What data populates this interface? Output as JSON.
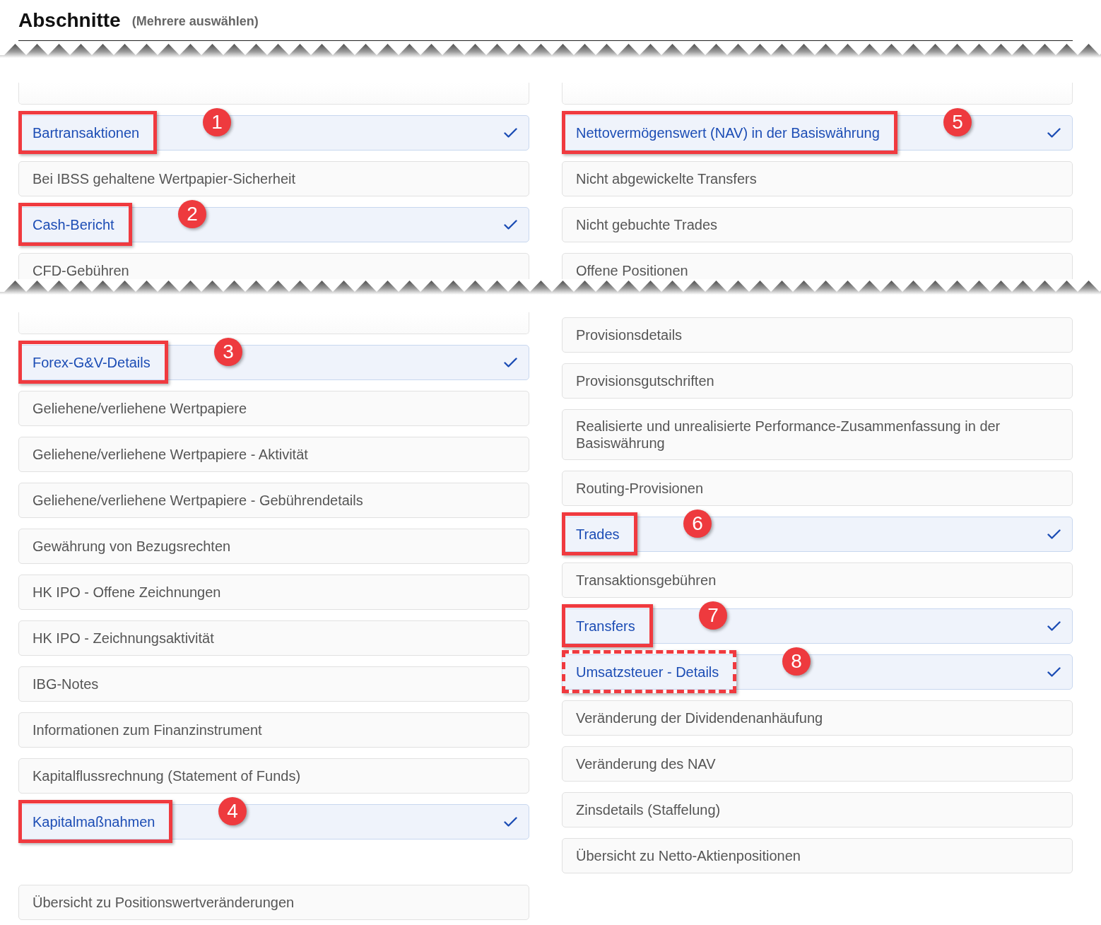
{
  "header": {
    "title": "Abschnitte",
    "hint": "(Mehrere auswählen)"
  },
  "segments": [
    {
      "columns": [
        {
          "items": [
            {
              "kind": "cut"
            },
            {
              "kind": "option",
              "label": "Bartransaktionen",
              "selected": true,
              "annotation": {
                "kind": "box",
                "number": "1"
              }
            },
            {
              "kind": "option",
              "label": "Bei IBSS gehaltene Wertpapier-Sicherheit",
              "selected": false
            },
            {
              "kind": "option",
              "label": "Cash-Bericht",
              "selected": true,
              "annotation": {
                "kind": "box",
                "number": "2"
              }
            },
            {
              "kind": "option",
              "label": "CFD-Gebühren",
              "selected": false
            }
          ]
        },
        {
          "items": [
            {
              "kind": "cut"
            },
            {
              "kind": "option",
              "label": "Nettovermögenswert (NAV) in der Basiswährung",
              "selected": true,
              "annotation": {
                "kind": "box",
                "number": "5"
              }
            },
            {
              "kind": "option",
              "label": "Nicht abgewickelte Transfers",
              "selected": false
            },
            {
              "kind": "option",
              "label": "Nicht gebuchte Trades",
              "selected": false
            },
            {
              "kind": "option",
              "label": "Offene Positionen",
              "selected": false
            }
          ]
        }
      ]
    },
    {
      "columns": [
        {
          "items": [
            {
              "kind": "cut"
            },
            {
              "kind": "option",
              "label": "Forex-G&V-Details",
              "selected": true,
              "annotation": {
                "kind": "box",
                "number": "3"
              }
            },
            {
              "kind": "option",
              "label": "Geliehene/verliehene Wertpapiere",
              "selected": false
            },
            {
              "kind": "option",
              "label": "Geliehene/verliehene Wertpapiere - Aktivität",
              "selected": false
            },
            {
              "kind": "option",
              "label": "Geliehene/verliehene Wertpapiere - Gebührendetails",
              "selected": false
            },
            {
              "kind": "option",
              "label": "Gewährung von Bezugsrechten",
              "selected": false
            },
            {
              "kind": "option",
              "label": "HK IPO - Offene Zeichnungen",
              "selected": false
            },
            {
              "kind": "option",
              "label": "HK IPO - Zeichnungsaktivität",
              "selected": false
            },
            {
              "kind": "option",
              "label": "IBG-Notes",
              "selected": false
            },
            {
              "kind": "option",
              "label": "Informationen zum Finanzinstrument",
              "selected": false
            },
            {
              "kind": "option",
              "label": "Kapitalflussrechnung (Statement of Funds)",
              "selected": false
            },
            {
              "kind": "option",
              "label": "Kapitalmaßnahmen",
              "selected": true,
              "annotation": {
                "kind": "box",
                "number": "4"
              }
            },
            {
              "kind": "gap"
            },
            {
              "kind": "option",
              "label": "Übersicht zu Positionswertveränderungen",
              "selected": false
            }
          ]
        },
        {
          "items": [
            {
              "kind": "option",
              "label": "Provisionsdetails",
              "selected": false
            },
            {
              "kind": "option",
              "label": "Provisionsgutschriften",
              "selected": false
            },
            {
              "kind": "option",
              "label": "Realisierte und unrealisierte Performance-Zusammenfassung in der Basiswährung",
              "selected": false
            },
            {
              "kind": "option",
              "label": "Routing-Provisionen",
              "selected": false
            },
            {
              "kind": "option",
              "label": "Trades",
              "selected": true,
              "annotation": {
                "kind": "box",
                "number": "6"
              }
            },
            {
              "kind": "option",
              "label": "Transaktionsgebühren",
              "selected": false
            },
            {
              "kind": "option",
              "label": "Transfers",
              "selected": true,
              "annotation": {
                "kind": "box",
                "number": "7"
              }
            },
            {
              "kind": "option",
              "label": "Umsatzsteuer - Details",
              "selected": true,
              "annotation": {
                "kind": "dashed-box",
                "number": "8"
              }
            },
            {
              "kind": "option",
              "label": "Veränderung der Dividendenanhäufung",
              "selected": false
            },
            {
              "kind": "option",
              "label": "Veränderung des NAV",
              "selected": false
            },
            {
              "kind": "option",
              "label": "Zinsdetails (Staffelung)",
              "selected": false
            },
            {
              "kind": "option",
              "label": "Übersicht zu Netto-Aktienpositionen",
              "selected": false
            }
          ]
        }
      ]
    }
  ]
}
